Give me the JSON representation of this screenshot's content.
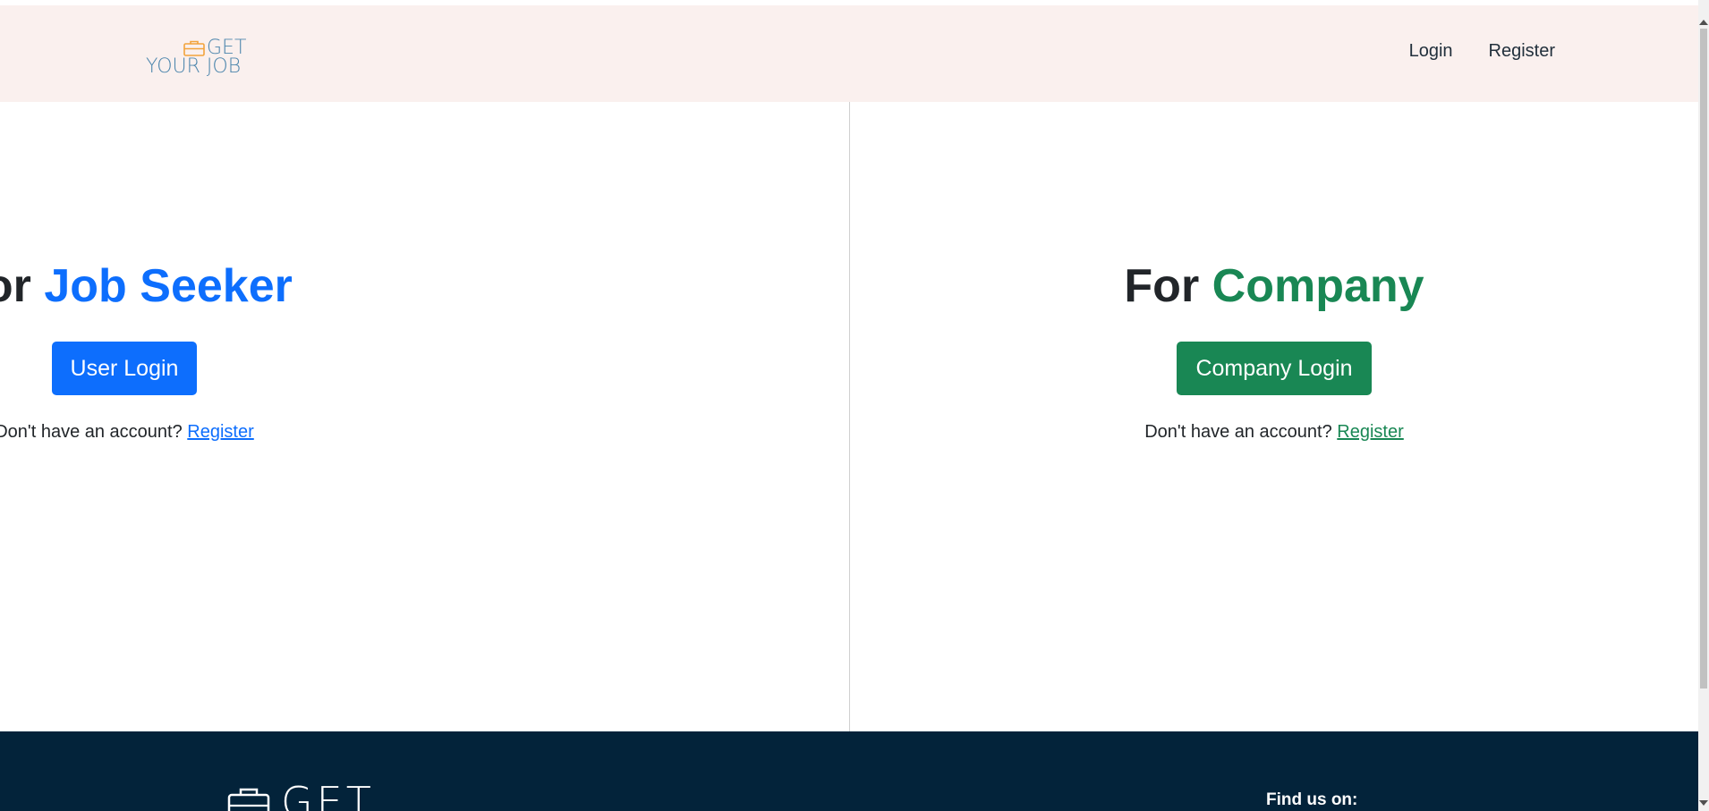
{
  "header": {
    "logo": {
      "line1": "GET",
      "line2": "YOUR JOB",
      "icon": "briefcase-icon",
      "icon_color": "#f2a33c",
      "text_color": "#4d86ad"
    },
    "nav": {
      "login_label": "Login",
      "register_label": "Register"
    },
    "background": "#faf0ee"
  },
  "job_seeker": {
    "title_prefix": "For",
    "title_accent": "Job Seeker",
    "accent_color": "#0d6efd",
    "button_label": "User Login",
    "account_text": "Don't have an account?",
    "register_link": "Register"
  },
  "company": {
    "title_prefix": "For",
    "title_accent": "Company",
    "accent_color": "#198754",
    "button_label": "Company Login",
    "account_text": "Don't have an account?",
    "register_link": "Register"
  },
  "footer": {
    "logo_text": "GET",
    "logo_icon": "briefcase-icon",
    "find_us_label": "Find us on:",
    "background": "#03233a"
  }
}
